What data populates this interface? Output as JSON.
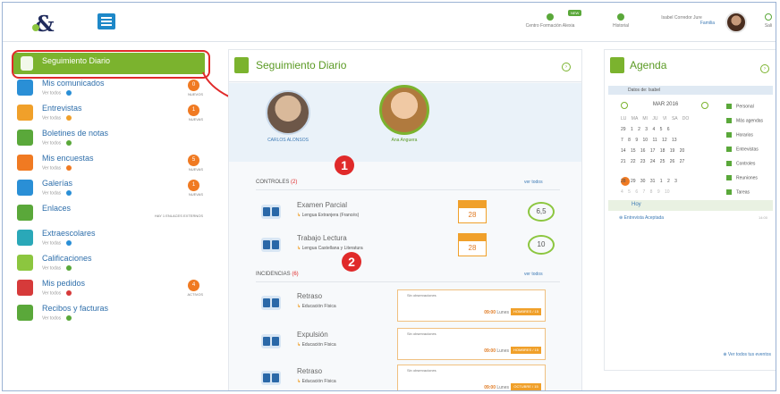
{
  "topbar": {
    "logo": "&",
    "items": [
      {
        "label": "Centro Formación Alexia",
        "badge": "NEW"
      },
      {
        "label": "Historial"
      },
      {
        "label": "Isabel Corredor Jure",
        "sublabel": "Familia"
      },
      {
        "label": "Sali"
      }
    ]
  },
  "sidebar": {
    "active": "Seguimiento Diario",
    "items": [
      {
        "label": "Mis comunicados",
        "sub": "Ver todos",
        "count": "0",
        "tag": "NUEVOS",
        "icon": "chat-icon",
        "color": "#2a8fd6",
        "dot": "#2a8fd6"
      },
      {
        "label": "Entrevistas",
        "sub": "Ver todas",
        "count": "1",
        "tag": "NUEVAS",
        "icon": "people-icon",
        "color": "#f0a02a",
        "dot": "#f0a02a"
      },
      {
        "label": "Boletines de notas",
        "sub": "Ver todos",
        "count": "",
        "tag": "",
        "icon": "document-icon",
        "color": "#5aa83a",
        "dot": "#5aa83a"
      },
      {
        "label": "Mis encuestas",
        "sub": "Ver todas",
        "count": "5",
        "tag": "NUEVAS",
        "icon": "survey-icon",
        "color": "#f07a22",
        "dot": "#f07a22"
      },
      {
        "label": "Galerías",
        "sub": "Ver todas",
        "count": "1",
        "tag": "NUEVAS",
        "icon": "gallery-icon",
        "color": "#2a8fd6",
        "dot": "#2a8fd6"
      },
      {
        "label": "Enlaces",
        "sub": "",
        "count": "",
        "tag": "HAY 1 ENLACES EXTERNOS",
        "icon": "link-icon",
        "color": "#5aa83a",
        "dot": ""
      },
      {
        "label": "Extraescolares",
        "sub": "Ver todas",
        "count": "",
        "tag": "",
        "icon": "extracurricular-icon",
        "color": "#2aa8b8",
        "dot": "#2a8fd6"
      },
      {
        "label": "Calificaciones",
        "sub": "Ver todas",
        "count": "",
        "tag": "",
        "icon": "grades-icon",
        "color": "#8cc63f",
        "dot": "#5aa83a"
      },
      {
        "label": "Mis pedidos",
        "sub": "Ver todos",
        "count": "4",
        "tag": "ACTIVOS",
        "icon": "gift-icon",
        "color": "#d63a3a",
        "dot": "#d63a3a"
      },
      {
        "label": "Recibos y facturas",
        "sub": "Ver todos",
        "count": "",
        "tag": "",
        "icon": "receipt-icon",
        "color": "#5aa83a",
        "dot": "#5aa83a"
      }
    ]
  },
  "seguimiento": {
    "title": "Seguimiento Diario",
    "students": [
      {
        "name": "CARLOS ALONSOS"
      },
      {
        "name": "Ana Anguera"
      }
    ],
    "controles": {
      "label": "CONTROLES",
      "count": "(2)",
      "ver": "ver todos",
      "rows": [
        {
          "title": "Examen Parcial",
          "subject": "Lengua Extranjera (Francés)",
          "day": "28",
          "score": "6,5"
        },
        {
          "title": "Trabajo Lectura",
          "subject": "Lengua Castellana y Literatura",
          "day": "28",
          "score": "10"
        }
      ]
    },
    "incidencias": {
      "label": "INCIDENCIAS",
      "count": "(6)",
      "ver": "ver todos",
      "rows": [
        {
          "title": "Retraso",
          "subject": "Educación Física",
          "obs": "Sin observaciones",
          "time": "09:00",
          "day": "Lunes",
          "badge": "HOMBRES / 15"
        },
        {
          "title": "Expulsión",
          "subject": "Educación Física",
          "obs": "Sin observaciones",
          "time": "09:00",
          "day": "Lunes",
          "badge": "HOMBRES / 15"
        },
        {
          "title": "Retraso",
          "subject": "Educación Física",
          "obs": "Sin observaciones",
          "time": "09:00",
          "day": "Lunes",
          "badge": "OCTUBRE / 15"
        }
      ]
    },
    "markers": [
      "1",
      "2"
    ]
  },
  "agenda": {
    "title": "Agenda",
    "datos_label": "Datos de:",
    "datos_value": "Isabel",
    "month": "MAR 2016",
    "weekdays": "LU MA MI JU VI SA DO",
    "weeks": [
      "29 1 2 3 4 5 6",
      "7 8 9 10 11 12 13",
      "14 15 16 17 18 19 20",
      "21 22 23 24 25 26 27",
      "28 29 30 31 1 2 3",
      "4 5 6 7 8 9 10"
    ],
    "filters": [
      "Personal",
      "Más agendas",
      "Horarios",
      "Entrevistas",
      "Controles",
      "Reuniones",
      "Tareas"
    ],
    "hoy": "Hoy",
    "event": "Entrevista Aceptada",
    "event_time": "14:00",
    "ver_eventos": "Ver todos tus eventos"
  }
}
